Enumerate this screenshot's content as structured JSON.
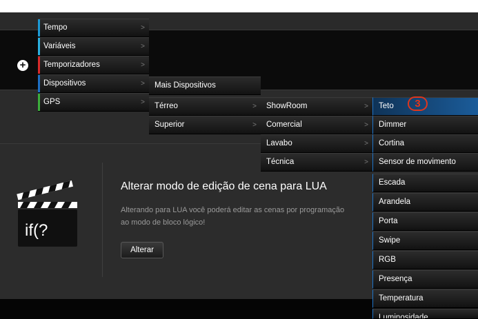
{
  "toolbar": {
    "add_icon": "plus-circle-icon",
    "add_glyph": "+"
  },
  "menu": {
    "level1": [
      {
        "label": "Tempo",
        "stripe": "#1c9ad6"
      },
      {
        "label": "Variáveis",
        "stripe": "#2bb0e0"
      },
      {
        "label": "Temporizadores",
        "stripe": "#d82a2a"
      },
      {
        "label": "Dispositivos",
        "stripe": "#1d6fc4"
      },
      {
        "label": "GPS",
        "stripe": "#3cae3c"
      }
    ],
    "level2": [
      {
        "label": "Mais Dispositivos"
      },
      {
        "label": "Térreo"
      },
      {
        "label": "Superior"
      }
    ],
    "level3": [
      {
        "label": "ShowRoom"
      },
      {
        "label": "Comercial"
      },
      {
        "label": "Lavabo"
      },
      {
        "label": "Técnica"
      }
    ],
    "level4": [
      {
        "label": "Teto"
      },
      {
        "label": "Dimmer"
      },
      {
        "label": "Cortina"
      },
      {
        "label": "Sensor de movimento"
      },
      {
        "label": "Escada"
      },
      {
        "label": "Arandela"
      },
      {
        "label": "Porta"
      },
      {
        "label": "Swipe"
      },
      {
        "label": "RGB"
      },
      {
        "label": "Presença"
      },
      {
        "label": "Temperatura"
      },
      {
        "label": "Luminosidade"
      }
    ],
    "arrow_glyph": ">",
    "badge": "3"
  },
  "dialog": {
    "icon_text": "if(?",
    "title": "Alterar modo de edição de cena para LUA",
    "text_line1": "Alterando para LUA você poderá editar as cenas por programação",
    "text_line2": "ao modo de bloco lógico!",
    "button_label": "Alterar"
  },
  "colors": {
    "accent": "#1f75c9",
    "badge": "#e0361c"
  }
}
